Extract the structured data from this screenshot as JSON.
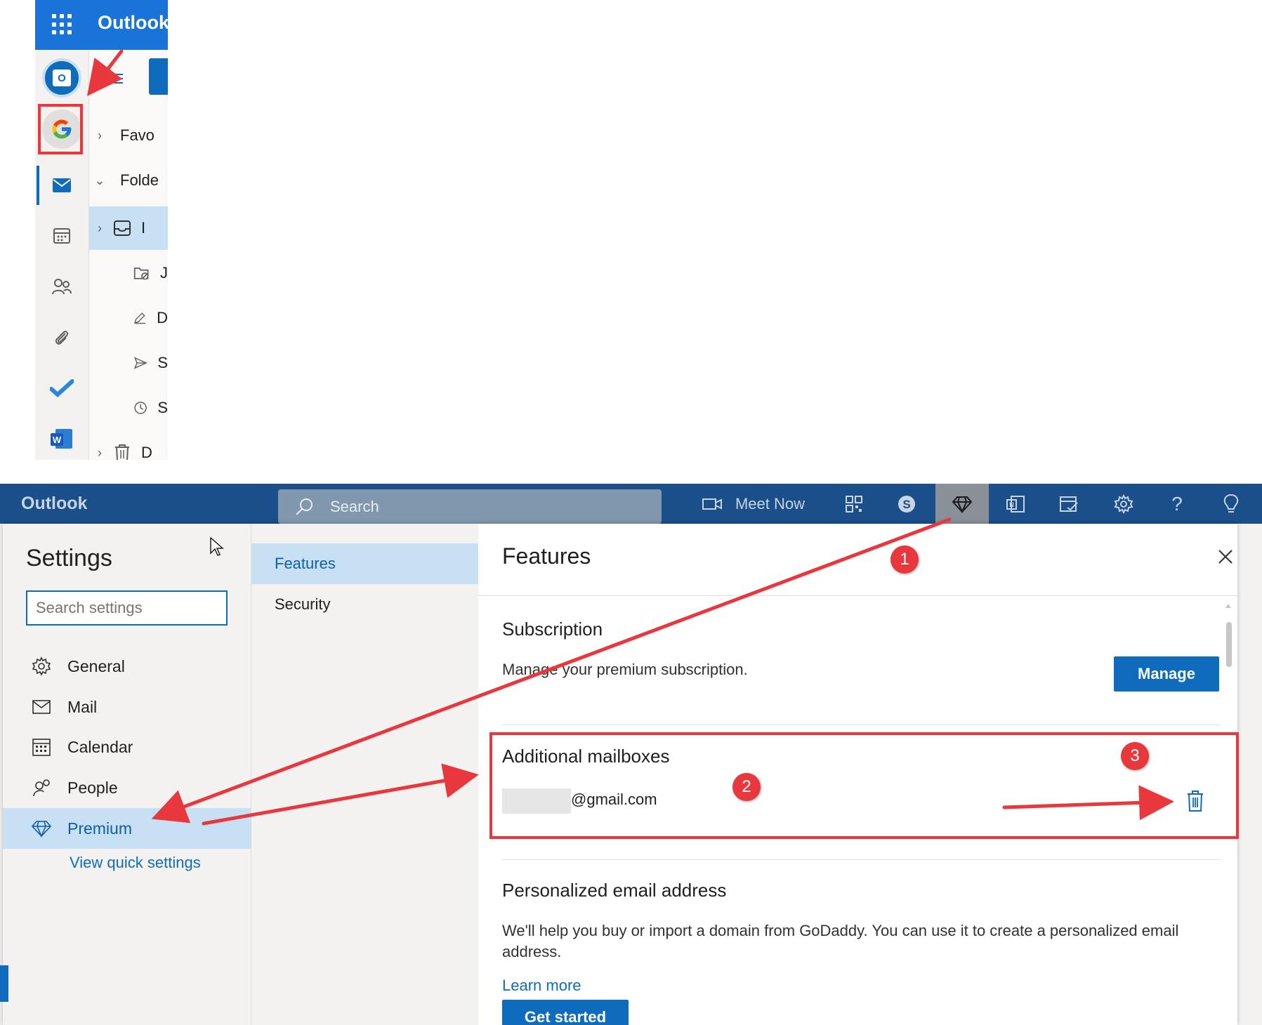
{
  "top_crop": {
    "app_title": "Outlook",
    "folders": [
      {
        "label": "Favo",
        "chevron": "right"
      },
      {
        "label": "Folde",
        "chevron": "down"
      },
      {
        "label": "I",
        "chevron": "right",
        "selected": true
      },
      {
        "label": "J"
      },
      {
        "label": "D"
      },
      {
        "label": "S"
      },
      {
        "label": "S"
      },
      {
        "label": "D",
        "chevron": "right"
      }
    ],
    "rail_icons": [
      "outlook-account-icon",
      "google-account-icon",
      "mail-icon",
      "calendar-icon",
      "people-icon",
      "attachment-icon",
      "todo-icon",
      "word-icon"
    ]
  },
  "topbar": {
    "app_title": "Outlook",
    "search_placeholder": "Search",
    "meet_now": "Meet Now"
  },
  "settings": {
    "heading": "Settings",
    "search_placeholder": "Search settings",
    "categories": [
      {
        "label": "General",
        "icon": "gear-icon"
      },
      {
        "label": "Mail",
        "icon": "mail-icon"
      },
      {
        "label": "Calendar",
        "icon": "calendar-icon"
      },
      {
        "label": "People",
        "icon": "people-icon"
      },
      {
        "label": "Premium",
        "icon": "diamond-icon",
        "selected": true
      }
    ],
    "quick_settings": "View quick settings",
    "subcategories": [
      {
        "label": "Features",
        "selected": true
      },
      {
        "label": "Security"
      }
    ]
  },
  "features": {
    "title": "Features",
    "subscription": {
      "title": "Subscription",
      "text": "Manage your premium subscription.",
      "button": "Manage"
    },
    "additional_mailboxes": {
      "title": "Additional mailboxes",
      "email_suffix": "@gmail.com"
    },
    "personalized": {
      "title": "Personalized email address",
      "text": "We'll help you buy or import a domain from GoDaddy. You can use it to create a personalized email address.",
      "learn_more": "Learn more",
      "button": "Get started"
    }
  },
  "annotations": {
    "badges": [
      "1",
      "2",
      "3"
    ],
    "color": "#e8383d"
  },
  "colors": {
    "brand_blue": "#0f6cbd",
    "selected_bg": "#c7e0f4",
    "topbar_dark": "#1a4f8a"
  }
}
